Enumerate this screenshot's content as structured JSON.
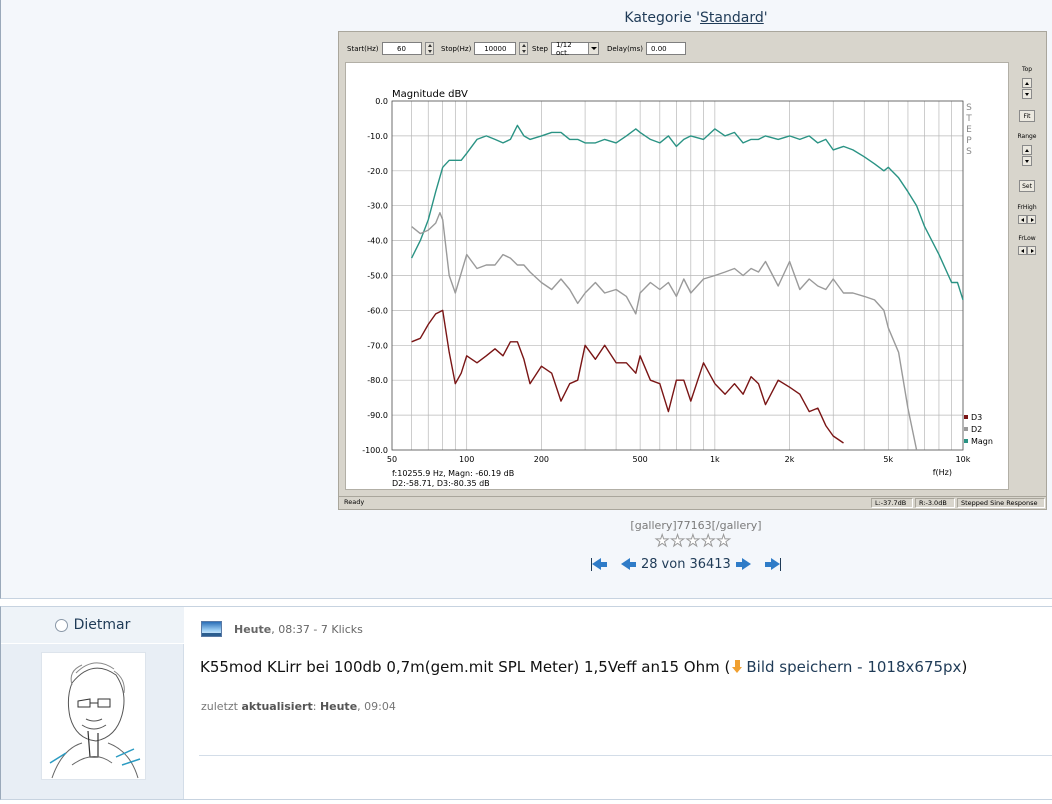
{
  "kategorie": {
    "prefix": "Kategorie '",
    "name": "Standard",
    "suffix": "'"
  },
  "rew_window": {
    "toolbar": {
      "start_label": "Start(Hz)",
      "start_value": "60",
      "stop_label": "Stop(Hz)",
      "stop_value": "10000",
      "step_label": "Step",
      "step_value": "1/12 oct.",
      "delay_label": "Delay(ms)",
      "delay_value": "0.00"
    },
    "side": {
      "top_label": "Top",
      "fit_label": "Fit",
      "range_label": "Range",
      "set_label": "Set",
      "frhigh_label": "FrHigh",
      "frlow_label": "FrLow"
    },
    "status": {
      "ready": "Ready",
      "left": "L:-37.7dB",
      "right": "R:-3.0dB",
      "mode": "Stepped Sine Response"
    }
  },
  "chart_data": {
    "type": "line",
    "title": "Magnitude dBV",
    "xlabel": "f(Hz)",
    "x_scale": "log",
    "xlim": [
      50,
      10000
    ],
    "ylim": [
      -100,
      0
    ],
    "x_ticks": [
      {
        "v": 50,
        "label": "50"
      },
      {
        "v": 100,
        "label": "100"
      },
      {
        "v": 200,
        "label": "200"
      },
      {
        "v": 500,
        "label": "500"
      },
      {
        "v": 1000,
        "label": "1k"
      },
      {
        "v": 2000,
        "label": "2k"
      },
      {
        "v": 5000,
        "label": "5k"
      },
      {
        "v": 10000,
        "label": "10k"
      }
    ],
    "y_ticks": [
      {
        "v": 0,
        "label": "0.0"
      },
      {
        "v": -10,
        "label": "-10.0"
      },
      {
        "v": -20,
        "label": "-20.0"
      },
      {
        "v": -30,
        "label": "-30.0"
      },
      {
        "v": -40,
        "label": "-40.0"
      },
      {
        "v": -50,
        "label": "-50.0"
      },
      {
        "v": -60,
        "label": "-60.0"
      },
      {
        "v": -70,
        "label": "-70.0"
      },
      {
        "v": -80,
        "label": "-80.0"
      },
      {
        "v": -90,
        "label": "-90.0"
      },
      {
        "v": -100,
        "label": "-100.0"
      }
    ],
    "grid": true,
    "side_text": "STEPS",
    "readout_line1": "f:10255.9 Hz, Magn: -60.19 dB",
    "readout_line2": "D2:-58.71, D3:-80.35 dB",
    "legend_position": "bottom-right",
    "series": [
      {
        "name": "Magn",
        "color": "#2a9384",
        "x": [
          60,
          65,
          70,
          75,
          80,
          85,
          90,
          95,
          100,
          110,
          120,
          130,
          140,
          150,
          160,
          170,
          180,
          200,
          220,
          240,
          260,
          280,
          300,
          330,
          360,
          400,
          440,
          480,
          500,
          550,
          600,
          650,
          700,
          750,
          800,
          900,
          1000,
          1100,
          1200,
          1300,
          1400,
          1500,
          1600,
          1800,
          2000,
          2200,
          2400,
          2600,
          2800,
          3000,
          3300,
          3600,
          4000,
          4400,
          4800,
          5000,
          5500,
          6000,
          6500,
          7000,
          8000,
          9000,
          9500,
          10000
        ],
        "y": [
          -45,
          -40,
          -34,
          -26,
          -19,
          -17,
          -17,
          -17,
          -15,
          -11,
          -10,
          -11,
          -12,
          -11,
          -7,
          -10,
          -11,
          -10,
          -9,
          -9,
          -11,
          -11,
          -12,
          -12,
          -11,
          -12,
          -10,
          -8,
          -9,
          -11,
          -12,
          -10,
          -13,
          -11,
          -10,
          -11,
          -8,
          -10,
          -9,
          -12,
          -11,
          -11,
          -10,
          -11,
          -10,
          -11,
          -10,
          -12,
          -11,
          -14,
          -13,
          -14,
          -16,
          -18,
          -20,
          -19,
          -22,
          -26,
          -30,
          -36,
          -44,
          -52,
          -52,
          -57
        ]
      },
      {
        "name": "D2",
        "color": "#9a9a9a",
        "x": [
          60,
          65,
          70,
          75,
          78,
          80,
          85,
          90,
          100,
          110,
          120,
          130,
          140,
          150,
          160,
          170,
          180,
          200,
          220,
          240,
          260,
          280,
          300,
          330,
          360,
          400,
          440,
          480,
          500,
          550,
          600,
          650,
          700,
          750,
          800,
          900,
          1000,
          1100,
          1200,
          1300,
          1400,
          1500,
          1600,
          1800,
          2000,
          2200,
          2400,
          2600,
          2800,
          3000,
          3300,
          3600,
          4000,
          4400,
          4800,
          5000,
          5500,
          6000,
          6500
        ],
        "y": [
          -36,
          -38,
          -37,
          -35,
          -32,
          -34,
          -50,
          -55,
          -44,
          -48,
          -47,
          -47,
          -44,
          -45,
          -47,
          -47,
          -49,
          -52,
          -54,
          -51,
          -54,
          -58,
          -55,
          -52,
          -55,
          -54,
          -56,
          -61,
          -55,
          -52,
          -54,
          -52,
          -56,
          -51,
          -55,
          -51,
          -50,
          -49,
          -48,
          -50,
          -48,
          -49,
          -46,
          -53,
          -46,
          -54,
          -51,
          -53,
          -54,
          -51,
          -55,
          -55,
          -56,
          -57,
          -60,
          -65,
          -72,
          -88,
          -100
        ]
      },
      {
        "name": "D3",
        "color": "#7a1515",
        "x": [
          60,
          65,
          70,
          75,
          80,
          85,
          90,
          95,
          100,
          110,
          120,
          130,
          140,
          150,
          160,
          170,
          180,
          200,
          220,
          240,
          260,
          280,
          300,
          330,
          360,
          400,
          440,
          480,
          500,
          550,
          600,
          650,
          700,
          750,
          800,
          900,
          1000,
          1100,
          1200,
          1300,
          1400,
          1500,
          1600,
          1800,
          2000,
          2200,
          2400,
          2600,
          2800,
          3000,
          3300
        ],
        "y": [
          -69,
          -68,
          -64,
          -61,
          -60,
          -72,
          -81,
          -78,
          -73,
          -75,
          -73,
          -71,
          -73,
          -69,
          -69,
          -74,
          -81,
          -76,
          -78,
          -86,
          -81,
          -80,
          -70,
          -74,
          -70,
          -75,
          -75,
          -78,
          -73,
          -80,
          -81,
          -89,
          -80,
          -80,
          -86,
          -75,
          -81,
          -84,
          -81,
          -84,
          -79,
          -81,
          -87,
          -80,
          -82,
          -84,
          -89,
          -88,
          -93,
          -96,
          -98
        ]
      }
    ]
  },
  "gallery_code": "[gallery]77163[/gallery]",
  "rating_stars": 0,
  "pager": {
    "current": "28",
    "sep": "von",
    "total": "36413"
  },
  "post": {
    "username": "Dietmar",
    "date": "Heute",
    "time_clicks": ", 08:37 - 7 Klicks",
    "title": "K55mod KLirr bei 100db 0,7m(gem.mit SPL Meter) 1,5Veff an15 Ohm (",
    "download_label": "Bild speichern - 1018x675px",
    "download_suffix": ")",
    "updated_prefix": "zuletzt ",
    "updated_bold": "aktualisiert",
    "updated_colon": ": ",
    "updated_date": "Heute",
    "updated_time": ", 09:04"
  }
}
